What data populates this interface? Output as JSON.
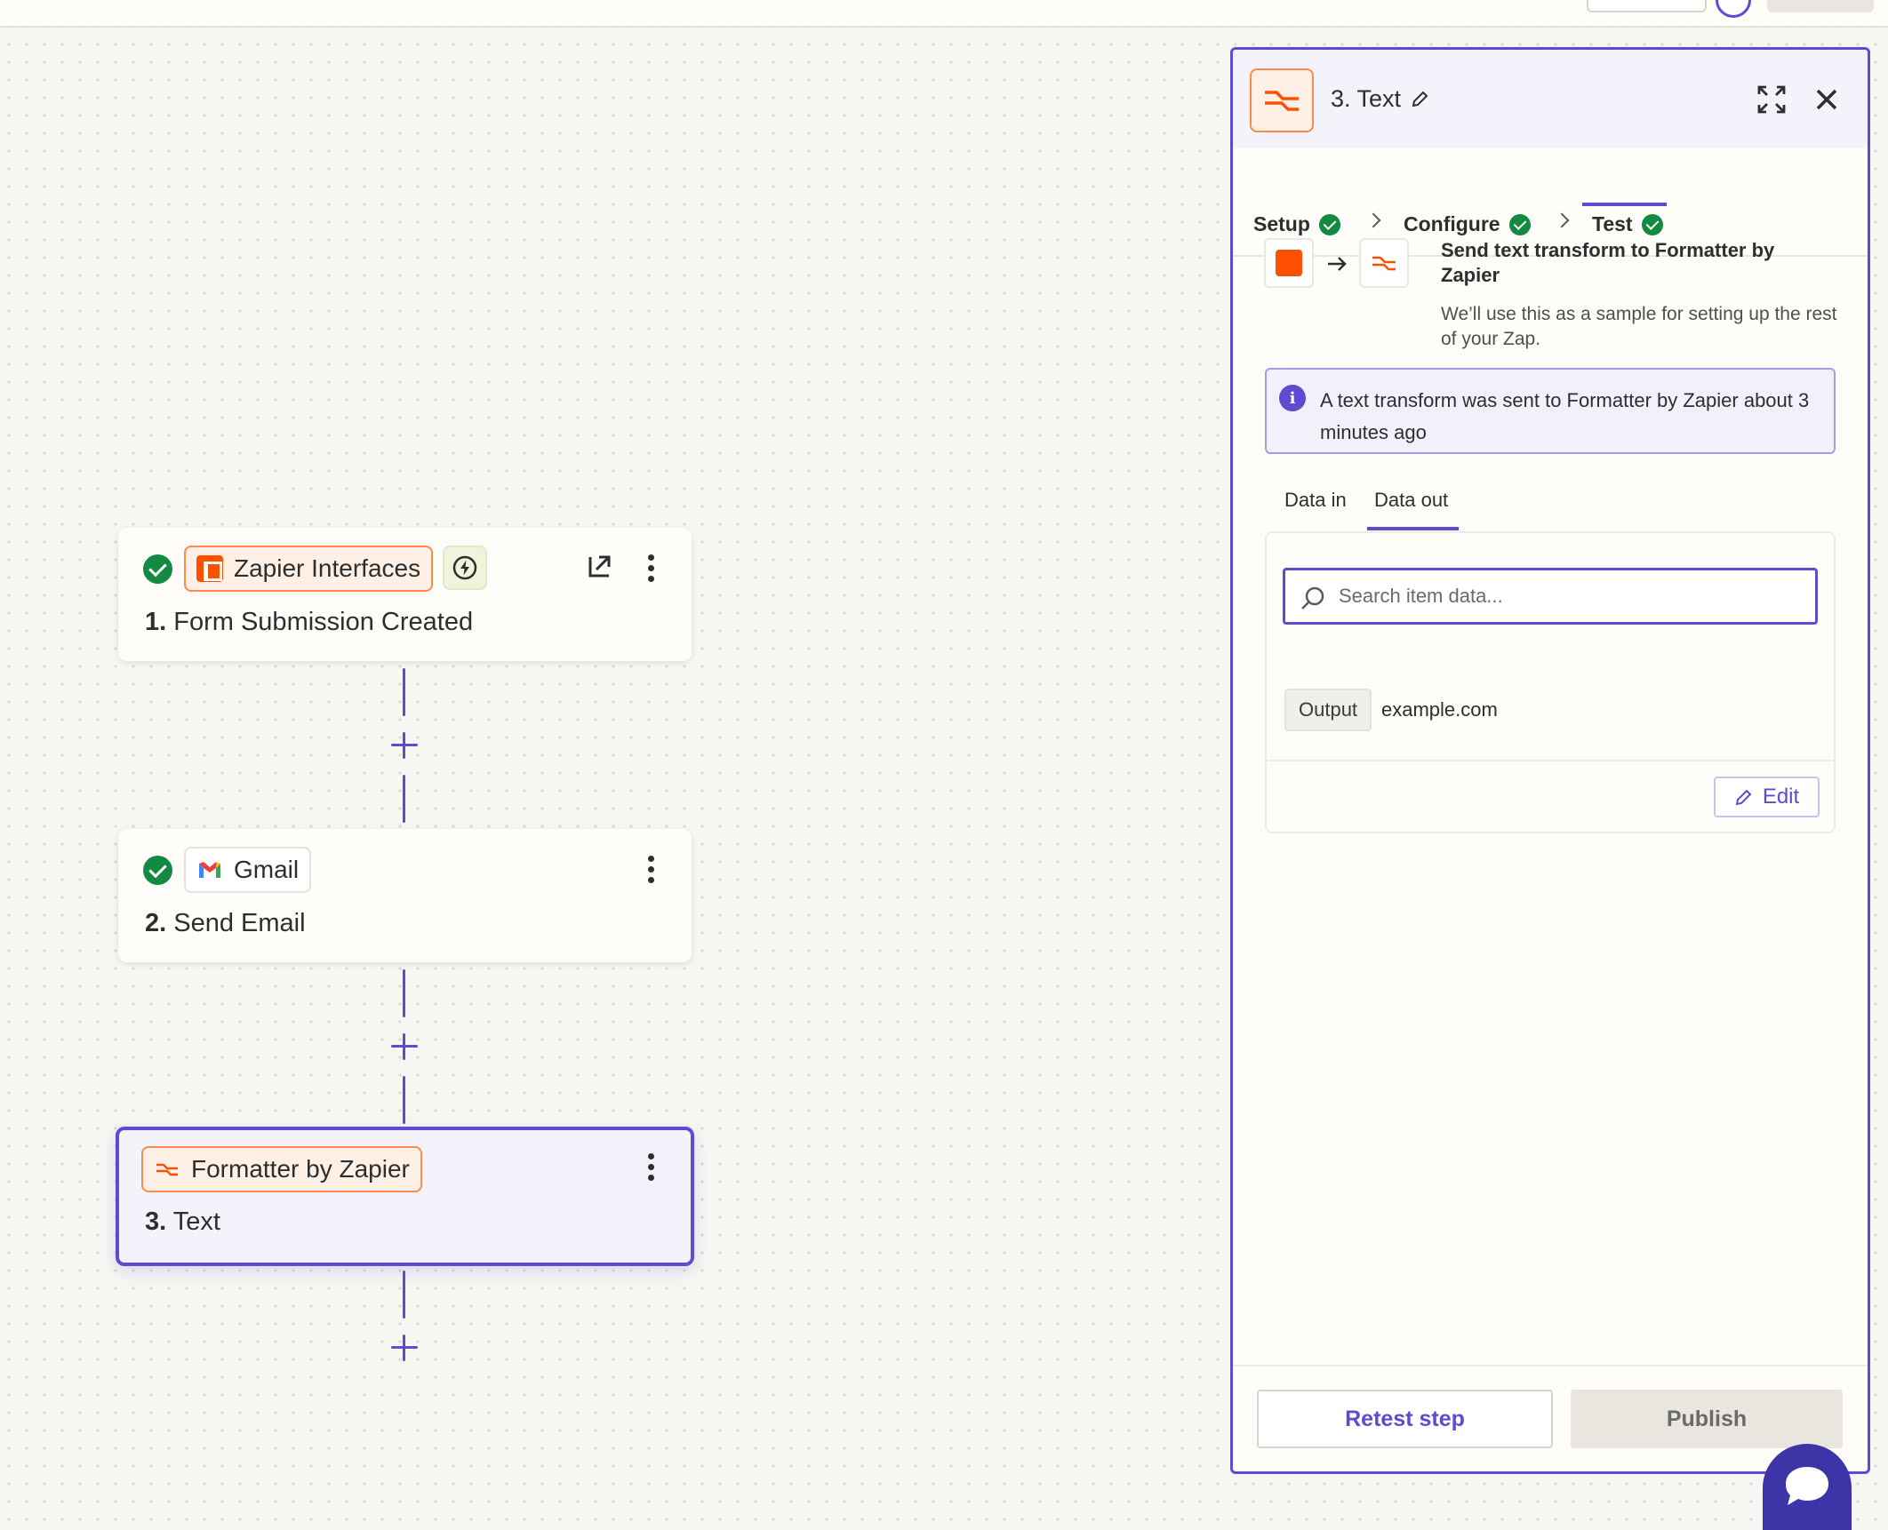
{
  "canvas": {
    "steps": [
      {
        "number": "1.",
        "name": "Form Submission Created",
        "app": "Zapier Interfaces",
        "status": "complete",
        "icons": [
          "check-icon",
          "zapier-interfaces-icon",
          "bolt-icon",
          "open-external-icon",
          "more-vertical-icon"
        ]
      },
      {
        "number": "2.",
        "name": "Send Email",
        "app": "Gmail",
        "status": "complete",
        "icons": [
          "check-icon",
          "gmail-icon",
          "more-vertical-icon"
        ]
      },
      {
        "number": "3.",
        "name": "Text",
        "app": "Formatter by Zapier",
        "status": "selected",
        "icons": [
          "formatter-icon",
          "more-vertical-icon"
        ]
      }
    ],
    "add_step_icon": "plus-icon"
  },
  "panel": {
    "title": "3. Text",
    "icons": [
      "formatter-icon",
      "pencil-icon",
      "expand-icon",
      "close-icon"
    ],
    "tabs": [
      {
        "label": "Setup",
        "status": "complete"
      },
      {
        "label": "Configure",
        "status": "complete"
      },
      {
        "label": "Test",
        "status": "complete",
        "active": true
      }
    ],
    "sample": {
      "title": "Send text transform to Formatter by Zapier",
      "description": "We’ll use this as a sample for setting up the rest of your Zap."
    },
    "info": {
      "text": "A text transform was sent to Formatter by Zapier about 3 minutes ago"
    },
    "data_tabs": [
      {
        "label": "Data in",
        "active": false
      },
      {
        "label": "Data out",
        "active": true
      }
    ],
    "search": {
      "placeholder": "Search item data...",
      "value": ""
    },
    "output": {
      "label": "Output",
      "value": "example.com"
    },
    "edit_label": "Edit",
    "footer": {
      "retest_label": "Retest step",
      "publish_label": "Publish"
    }
  },
  "colors": {
    "accent": "#5d4bd1",
    "success": "#138a41",
    "zapier_orange": "#ff4f00",
    "canvas_bg": "#f7f6f3"
  }
}
